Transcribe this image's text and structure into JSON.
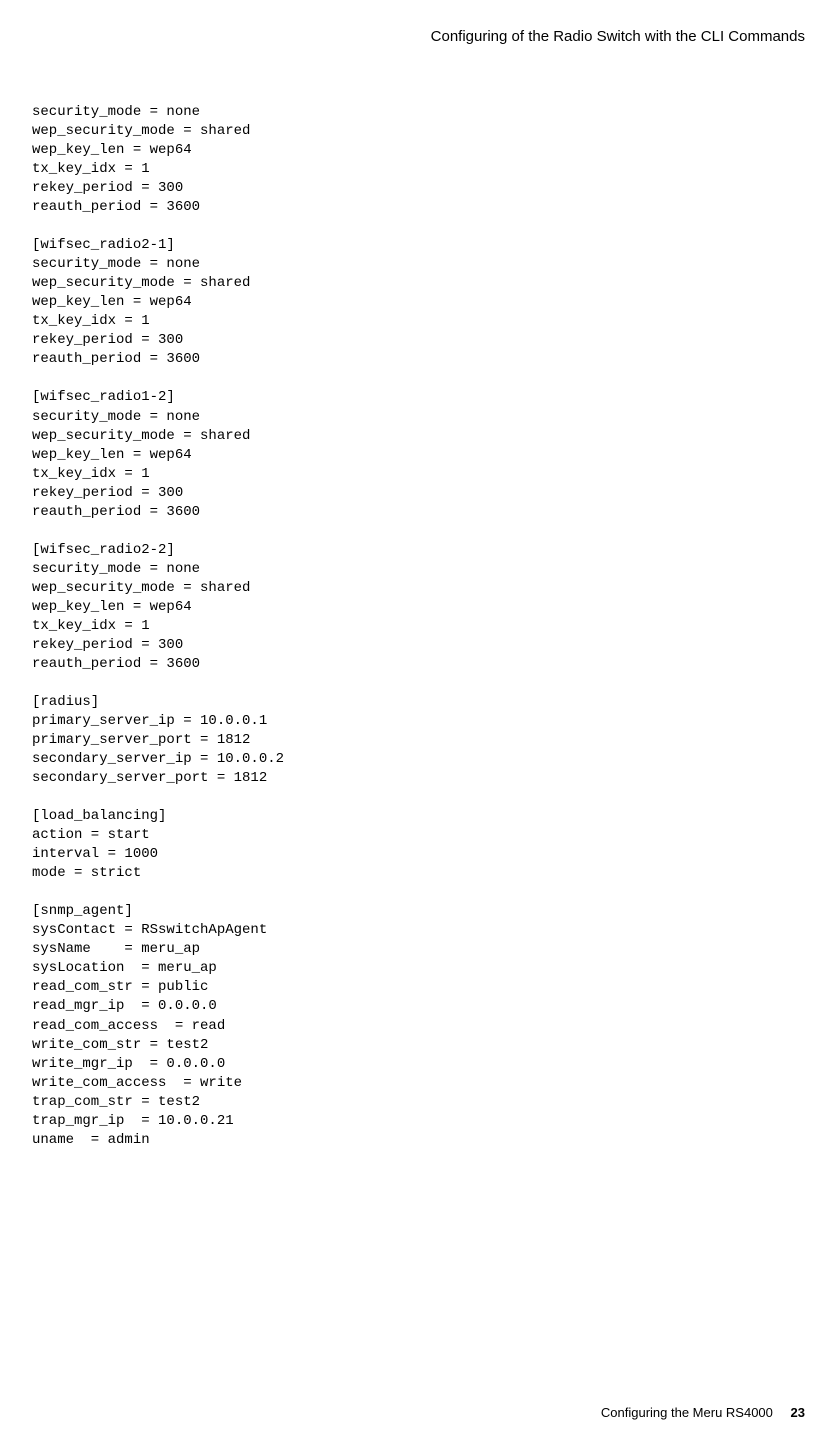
{
  "header": {
    "title": "Configuring of the Radio Switch with the CLI Commands"
  },
  "config_text": "security_mode = none\nwep_security_mode = shared\nwep_key_len = wep64\ntx_key_idx = 1\nrekey_period = 300\nreauth_period = 3600\n\n[wifsec_radio2-1]\nsecurity_mode = none\nwep_security_mode = shared\nwep_key_len = wep64\ntx_key_idx = 1\nrekey_period = 300\nreauth_period = 3600\n\n[wifsec_radio1-2]\nsecurity_mode = none\nwep_security_mode = shared\nwep_key_len = wep64\ntx_key_idx = 1\nrekey_period = 300\nreauth_period = 3600\n\n[wifsec_radio2-2]\nsecurity_mode = none\nwep_security_mode = shared\nwep_key_len = wep64\ntx_key_idx = 1\nrekey_period = 300\nreauth_period = 3600\n\n[radius]\nprimary_server_ip = 10.0.0.1\nprimary_server_port = 1812\nsecondary_server_ip = 10.0.0.2\nsecondary_server_port = 1812\n\n[load_balancing]\naction = start\ninterval = 1000\nmode = strict\n\n[snmp_agent]\nsysContact = RSswitchApAgent\nsysName    = meru_ap\nsysLocation  = meru_ap\nread_com_str = public\nread_mgr_ip  = 0.0.0.0\nread_com_access  = read\nwrite_com_str = test2\nwrite_mgr_ip  = 0.0.0.0\nwrite_com_access  = write\ntrap_com_str = test2\ntrap_mgr_ip  = 10.0.0.21\nuname  = admin",
  "footer": {
    "text": "Configuring the Meru RS4000",
    "page": "23"
  }
}
